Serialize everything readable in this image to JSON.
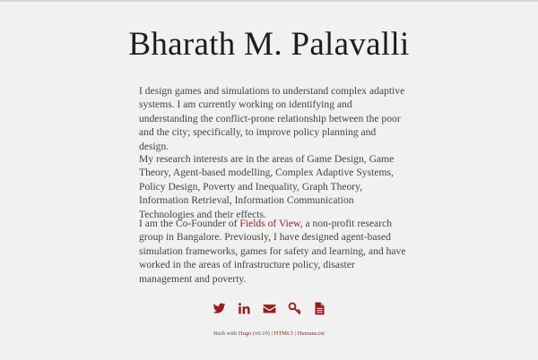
{
  "header": {
    "title": "Bharath M. Palavalli"
  },
  "about": {
    "p1": "I design games and simulations to understand complex adaptive systems. I am currently working on identifying and understanding the conflict-prone relationship between the poor and the city; specifically, to improve policy planning and design.",
    "p2": "My research interests are in the areas of Game Design, Game Theory, Agent-based modelling, Complex Adaptive Systems, Policy Design, Poverty and Inequality, Graph Theory, Information Retrieval, Information Communication Technologies and their effects.",
    "p3_before": "I am the Co-Founder of ",
    "p3_link": "Fields of View",
    "p3_after": ", a non-profit research group in Bangalore. Previously, I have designed agent-based simulation frameworks, games for safety and learning, and have worked in the areas of infrastructure policy, disaster management and poverty."
  },
  "social": {
    "icons": [
      "twitter-icon",
      "linkedin-icon",
      "email-icon",
      "key-icon",
      "document-icon"
    ],
    "color": "#9b1b1b"
  },
  "footer": {
    "built_with": "Built with ",
    "hugo": "Hugo",
    "version": " (v0.19) | ",
    "html5": "HTML5",
    "sep": " | ",
    "humans": "Humans.txt"
  }
}
